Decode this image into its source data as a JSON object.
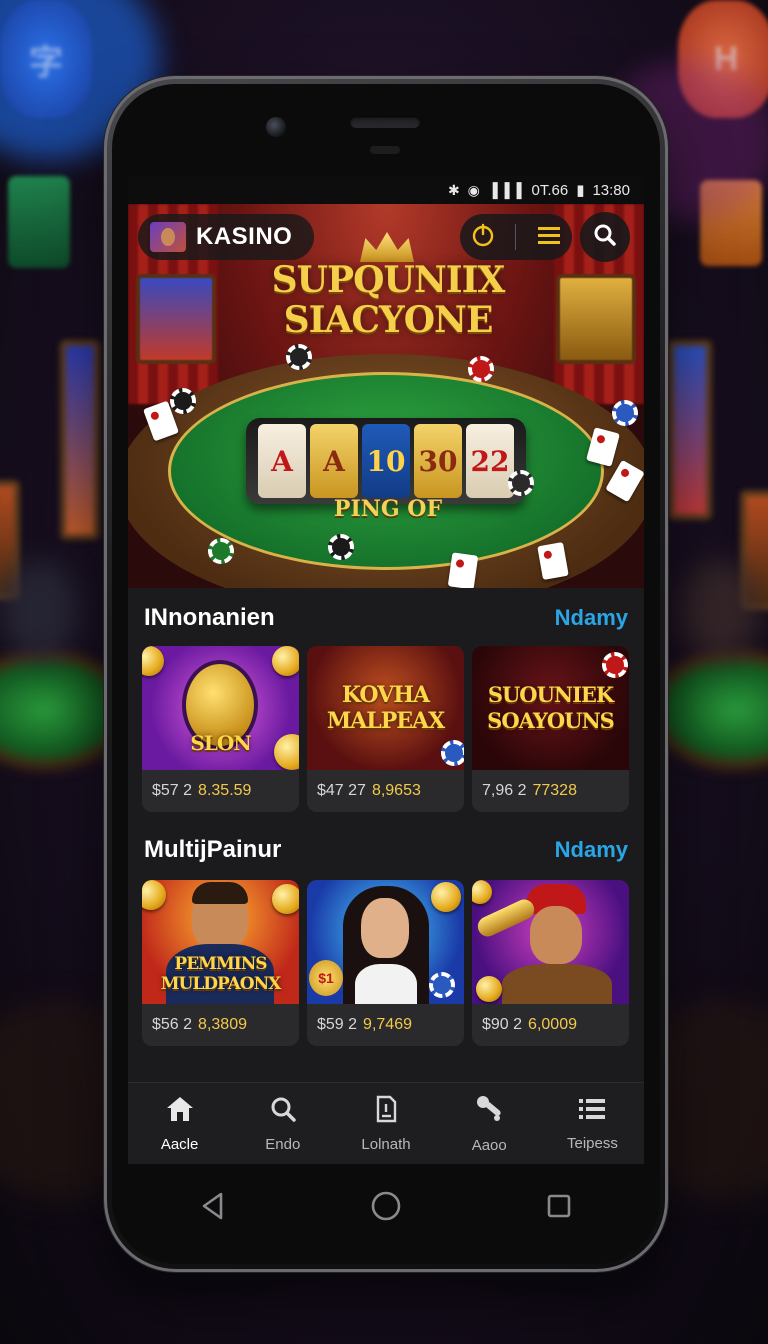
{
  "status_bar": {
    "signal_icons": "✱ ◉ ▐▐▐",
    "network": "0T.66",
    "battery": "▮",
    "time": "13:80"
  },
  "header": {
    "brand": "KASINO",
    "icons": [
      "avatar",
      "power-icon",
      "menu-icon",
      "search-icon"
    ]
  },
  "hero": {
    "title_line1": "SUPQUNIIX",
    "title_line2": "SIACYONE",
    "subtitle": "PING OF",
    "reels": [
      "A",
      "A",
      "10",
      "30",
      "22"
    ]
  },
  "sections": [
    {
      "title": "INnonanien",
      "link": "Ndamy",
      "tiles": [
        {
          "art": "SLON",
          "price_a": "$57 2",
          "price_b": "8.35.59"
        },
        {
          "art": "KOVHA MALPEAX",
          "price_a": "$47 27",
          "price_b": "8,9653"
        },
        {
          "art": "SUOUNIEK SOAYOUNS",
          "price_a": "7,96 2",
          "price_b": "77328"
        }
      ]
    },
    {
      "title": "MultijPainur",
      "link": "Ndamy",
      "tiles": [
        {
          "art": "PEMMINS MULDPAONX",
          "price_a": "$56 2",
          "price_b": "8,3809"
        },
        {
          "art": "$1",
          "price_a": "$59 2",
          "price_b": "9,7469"
        },
        {
          "art": "",
          "price_a": "$90 2",
          "price_b": "6,0009"
        }
      ]
    }
  ],
  "bottom_nav": [
    {
      "label": "Aacle",
      "icon": "home-icon",
      "active": true
    },
    {
      "label": "Endo",
      "icon": "search-icon",
      "active": false
    },
    {
      "label": "Lolnath",
      "icon": "document-icon",
      "active": false
    },
    {
      "label": "Aaoo",
      "icon": "tools-icon",
      "active": false
    },
    {
      "label": "Teipess",
      "icon": "list-icon",
      "active": false
    }
  ],
  "colors": {
    "accent_link": "#2aa6e6",
    "price_gold": "#f2c94c",
    "screen_bg": "#1b1b1d"
  }
}
